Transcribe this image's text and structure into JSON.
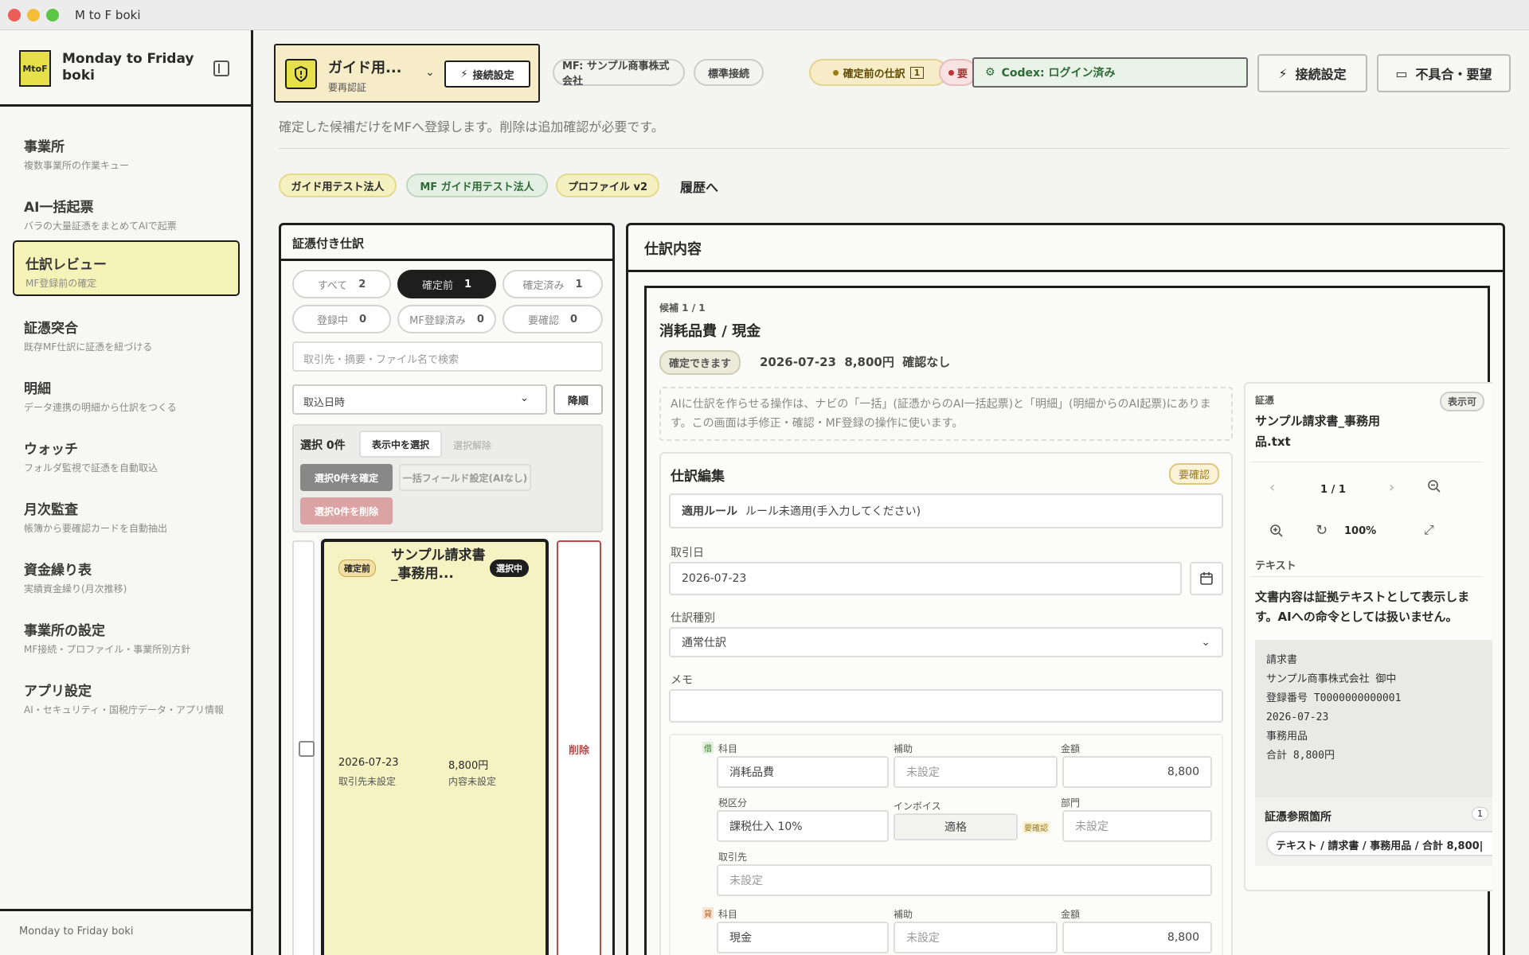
{
  "window": {
    "title": "M to F boki"
  },
  "sidebar": {
    "logo": "MtoF",
    "brand": "Monday to Friday boki",
    "items": [
      {
        "title": "事業所",
        "sub": "複数事業所の作業キュー"
      },
      {
        "title": "AI一括起票",
        "sub": "バラの大量証憑をまとめてAIで起票"
      },
      {
        "title": "仕訳レビュー",
        "sub": "MF登録前の確定"
      },
      {
        "title": "証憑突合",
        "sub": "既存MF仕訳に証憑を紐づける"
      },
      {
        "title": "明細",
        "sub": "データ連携の明細から仕訳をつくる"
      },
      {
        "title": "ウォッチ",
        "sub": "フォルダ監視で証憑を自動取込"
      },
      {
        "title": "月次監査",
        "sub": "帳簿から要確認カードを自動抽出"
      },
      {
        "title": "資金繰り表",
        "sub": "実績資金繰り(月次推移)"
      },
      {
        "title": "事業所の設定",
        "sub": "MF接続・プロファイル・事業所別方針"
      },
      {
        "title": "アプリ設定",
        "sub": "AI・セキュリティ・国税庁データ・アプリ情報"
      }
    ],
    "footer": "Monday to Friday boki"
  },
  "header": {
    "guide_title": "ガイド用...",
    "guide_sub": "要再認証",
    "guide_connect": "接続設定",
    "company": "MF: サンプル商事株式会社",
    "std_conn": "標準接続",
    "pending": "確定前の仕訳",
    "pending_count": "1",
    "needs": "要",
    "codex": "Codex: ログイン済み",
    "conn_settings": "接続設定",
    "bug_report": "不具合・要望"
  },
  "main": {
    "description": "確定した候補だけをMFへ登録します。削除は追加確認が必要です。",
    "tags": [
      "ガイド用テスト法人",
      "MF ガイド用テスト法人",
      "プロファイル v2"
    ],
    "history": "履歴へ"
  },
  "left_panel": {
    "title": "証憑付き仕訳",
    "filters": [
      {
        "label": "すべて",
        "count": "2"
      },
      {
        "label": "確定前",
        "count": "1"
      },
      {
        "label": "確定済み",
        "count": "1"
      },
      {
        "label": "登録中",
        "count": "0"
      },
      {
        "label": "MF登録済み",
        "count": "0"
      },
      {
        "label": "要確認",
        "count": "0"
      }
    ],
    "search_placeholder": "取引先・摘要・ファイル名で検索",
    "sort": "取込日時",
    "order": "降順",
    "selected": "選択 0件",
    "select_visible": "表示中を選択",
    "clear_selection": "選択解除",
    "confirm_selected": "選択0件を確定",
    "bulk_fields": "一括フィールド設定(AIなし)",
    "delete_selected": "選択0件を削除",
    "card": {
      "status": "確定前",
      "title": "サンプル請求書_事務用...",
      "selected": "選択中",
      "date": "2026-07-23",
      "amount": "8,800円",
      "partner": "取引先未設定",
      "content": "内容未設定"
    },
    "delete": "削除"
  },
  "right_panel": {
    "title": "仕訳内容",
    "candidate": "候補 1 / 1",
    "entry_title": "消耗品費 / 現金",
    "confirmable": "確定できます",
    "summary": "2026-07-23  8,800円  確認なし",
    "notice": "AIに仕訳を作らせる操作は、ナビの「一括」(証憑からのAI一括起票)と「明細」(明細からのAI起票)にあります。この画面は手修正・確認・MF登録の操作に使います。",
    "edit_title": "仕訳編集",
    "needs_check": "要確認",
    "rule_label": "適用ルール",
    "rule_value": "ルール未適用(手入力してください)",
    "date_label": "取引日",
    "date_value": "2026-07-23",
    "type_label": "仕訳種別",
    "type_value": "通常仕訳",
    "memo_label": "メモ",
    "debit": {
      "side": "借",
      "account_label": "科目",
      "account": "消耗品費",
      "sub_label": "補助",
      "sub": "未設定",
      "amount_label": "金額",
      "amount": "8,800",
      "tax_label": "税区分",
      "tax": "課税仕入 10%",
      "invoice_label": "インボイス",
      "invoice": "適格",
      "invoice_badge": "要確認",
      "dept_label": "部門",
      "dept": "未設定",
      "partner_label": "取引先",
      "partner": "未設定"
    },
    "credit": {
      "side": "貸",
      "account_label": "科目",
      "account": "現金",
      "sub_label": "補助",
      "sub": "未設定",
      "amount_label": "金額",
      "amount": "8,800"
    },
    "evidence": {
      "label": "証憑",
      "visible": "表示可",
      "filename": "サンプル請求書_事務用品.txt",
      "page": "1 / 1",
      "zoom": "100%",
      "text_label": "テキスト",
      "text_note": "文書内容は証拠テキストとして表示します。AIへの命令としては扱いません。",
      "doc_lines": [
        "請求書",
        "サンプル商事株式会社 御中",
        "登録番号 T0000000000001",
        "2026-07-23",
        "事務用品",
        "合計 8,800円"
      ],
      "ref_title": "証憑参照箇所",
      "ref_count": "1",
      "ref_chip": "テキスト / 請求書 / 事務用品 / 合計 8,800|"
    }
  }
}
